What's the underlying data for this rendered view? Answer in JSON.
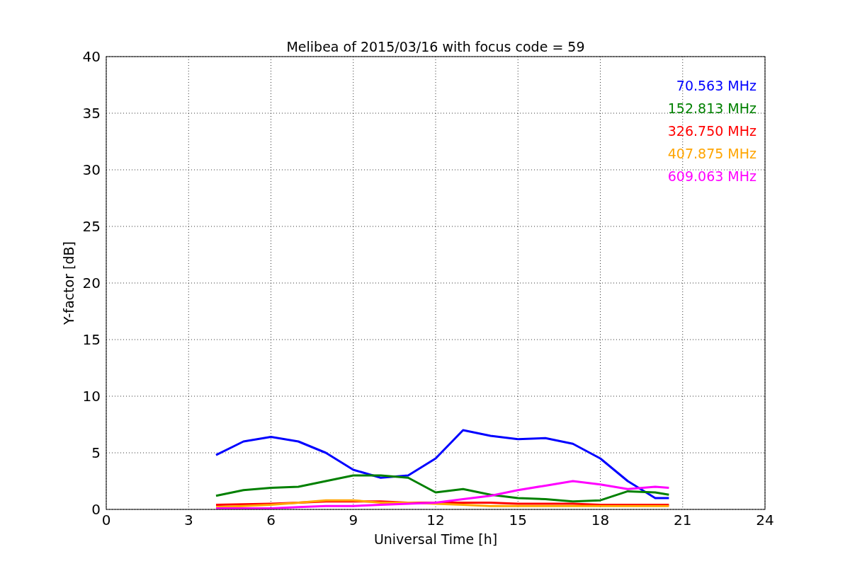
{
  "chart": {
    "chart_data": {
      "type": "line",
      "title": "Melibea of 2015/03/16 with focus code = 59",
      "xlabel": "Universal Time [h]",
      "ylabel": "Y-factor [dB]",
      "x": [
        4,
        5,
        6,
        7,
        8,
        9,
        10,
        11,
        12,
        13,
        14,
        15,
        16,
        17,
        18,
        19,
        20,
        20.5
      ],
      "series": [
        {
          "name": "70.563 MHz",
          "color": "#0000ff",
          "values": [
            4.8,
            6.0,
            6.4,
            6.0,
            5.0,
            3.5,
            2.8,
            3.0,
            4.5,
            7.0,
            6.5,
            6.2,
            6.3,
            5.8,
            4.5,
            2.5,
            1.0,
            1.0
          ]
        },
        {
          "name": "152.813 MHz",
          "color": "#008000",
          "values": [
            1.2,
            1.7,
            1.9,
            2.0,
            2.5,
            3.0,
            3.0,
            2.8,
            1.5,
            1.8,
            1.3,
            1.0,
            0.9,
            0.7,
            0.8,
            1.6,
            1.5,
            1.3
          ]
        },
        {
          "name": "326.750 MHz",
          "color": "#ff0000",
          "values": [
            0.4,
            0.45,
            0.5,
            0.6,
            0.7,
            0.7,
            0.7,
            0.6,
            0.6,
            0.6,
            0.6,
            0.5,
            0.5,
            0.5,
            0.4,
            0.4,
            0.4,
            0.4
          ]
        },
        {
          "name": "407.875 MHz",
          "color": "#ffa500",
          "values": [
            0.2,
            0.3,
            0.4,
            0.6,
            0.8,
            0.8,
            0.6,
            0.6,
            0.5,
            0.4,
            0.3,
            0.3,
            0.3,
            0.3,
            0.3,
            0.3,
            0.3,
            0.3
          ]
        },
        {
          "name": "609.063 MHz",
          "color": "#ff00ff",
          "values": [
            0.1,
            0.1,
            0.1,
            0.2,
            0.3,
            0.3,
            0.4,
            0.5,
            0.6,
            0.9,
            1.2,
            1.7,
            2.1,
            2.5,
            2.2,
            1.8,
            2.0,
            1.9
          ]
        }
      ],
      "grid": true,
      "xlim": [
        0,
        24
      ],
      "ylim": [
        0,
        40
      ],
      "xticks": [
        0,
        3,
        6,
        9,
        12,
        15,
        18,
        21,
        24
      ],
      "yticks": [
        0,
        5,
        10,
        15,
        20,
        25,
        30,
        35,
        40
      ]
    }
  }
}
